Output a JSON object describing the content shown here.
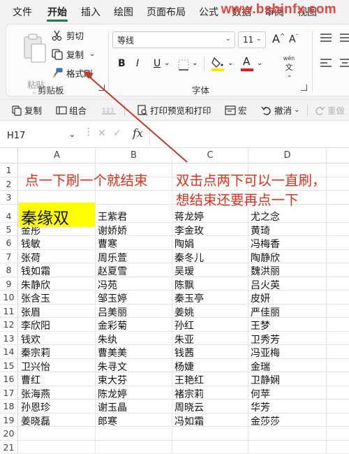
{
  "menu": {
    "items": [
      "文件",
      "开始",
      "插入",
      "绘图",
      "页面布局",
      "公式",
      "数据",
      "审阅",
      "视图"
    ],
    "active": "开始"
  },
  "watermark": "www.bsbinfx.com",
  "ribbon": {
    "clipboard": {
      "paste_label": "粘贴",
      "cut_label": "剪切",
      "copy_label": "复制",
      "format_painter_label": "格式刷",
      "group_label": "剪贴板"
    },
    "font": {
      "font_name": "等线",
      "font_size": "11",
      "bold": "B",
      "italic": "I",
      "underline": "U",
      "grow": "A",
      "shrink": "A",
      "font_color": "A",
      "phonetic_top": "wén",
      "phonetic_bottom": "文",
      "group_label": "字体"
    }
  },
  "qat": {
    "copy_label": "复制",
    "group_label": "组合",
    "print_preview_label": "打印预览和打印",
    "macro_label": "宏",
    "undo_label": "撤消",
    "redo_label": "重做"
  },
  "formula_bar": {
    "name_box": "H17",
    "fx": "fx",
    "content": ""
  },
  "grid": {
    "columns": [
      "A",
      "B",
      "C",
      "D"
    ],
    "rows": [
      "1",
      "2",
      "3",
      "4",
      "5",
      "6",
      "7",
      "8",
      "9",
      "10",
      "11",
      "12",
      "13",
      "14",
      "15",
      "16",
      "17",
      "18",
      "19",
      "20",
      "21"
    ],
    "highlight_cell": "秦缘双",
    "data_rows": [
      [
        "金彤",
        "谢娇娇",
        "李金玫",
        "黄琦"
      ],
      [
        "钱敏",
        "曹寒",
        "陶娟",
        "冯梅香"
      ],
      [
        "张荷",
        "周乐萱",
        "秦冬儿",
        "陶静欣"
      ],
      [
        "钱如霜",
        "赵夏雪",
        "吴瑷",
        "魏洪丽"
      ],
      [
        "朱静欣",
        "冯苑",
        "陈飘",
        "吕火英"
      ],
      [
        "张含玉",
        "邹玉婷",
        "秦玉亭",
        "皮妍"
      ],
      [
        "张眉",
        "吕美丽",
        "姜姚",
        "严佳丽"
      ],
      [
        "李欣阳",
        "金彩菊",
        "孙红",
        "王梦"
      ],
      [
        "钱欢",
        "朱纨",
        "朱亚",
        "卫秀芳"
      ],
      [
        "秦宗莉",
        "曹美美",
        "钱茜",
        "冯亚梅"
      ],
      [
        "卫兴怡",
        "朱寻文",
        "杨婕",
        "金瑞"
      ],
      [
        "曹红",
        "束大芬",
        "王艳红",
        "卫静娴"
      ],
      [
        "张海燕",
        "陈龙婷",
        "褚宗莉",
        "何苹"
      ],
      [
        "孙恩珍",
        "谢玉晶",
        "周晓云",
        "华芳"
      ],
      [
        "姜晓磊",
        "郎寒",
        "冯如霜",
        "金莎莎"
      ]
    ],
    "row4_other": [
      "王紫君",
      "蒋龙婷",
      "尤之念"
    ]
  },
  "annotations": {
    "left": "点一下刷一个就结束",
    "right_line1": "双击点两下可以一直刷，",
    "right_line2": "想结束还要再点一下",
    "arrow_color": "#c0392b",
    "text_color": "#e0301e"
  },
  "colors": {
    "accent": "#1e7a45",
    "highlight": "#ffff00"
  }
}
